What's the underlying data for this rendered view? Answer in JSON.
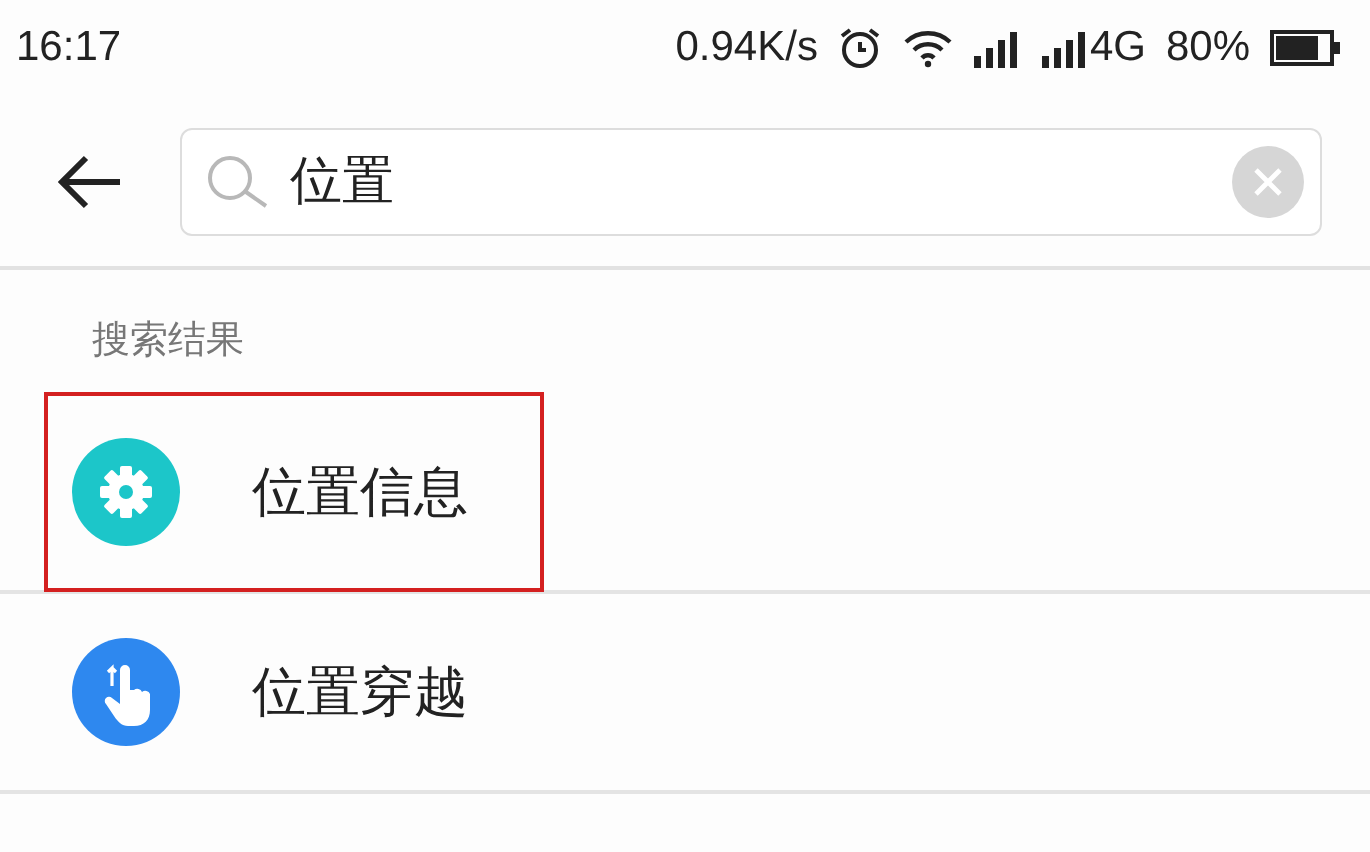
{
  "status_bar": {
    "time": "16:17",
    "speed": "0.94K/s",
    "network": "4G",
    "battery": "80%"
  },
  "search": {
    "value": "位置"
  },
  "section_title": "搜索结果",
  "results": [
    {
      "label": "位置信息",
      "kind": "gear",
      "color": "#1cc6c9",
      "highlighted": true
    },
    {
      "label": "位置穿越",
      "kind": "hand",
      "color": "#2e88ef",
      "highlighted": false
    }
  ]
}
